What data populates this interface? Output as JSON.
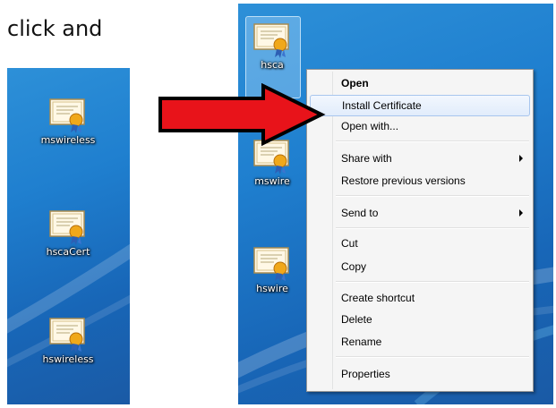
{
  "caption": "click and",
  "left_desktop": {
    "icons": [
      {
        "label": "mswireless",
        "icon": "certificate-icon"
      },
      {
        "label": "hscaCert",
        "icon": "certificate-icon"
      },
      {
        "label": "hswireless",
        "icon": "certificate-icon"
      }
    ]
  },
  "right_desktop": {
    "icons": [
      {
        "label": "hsca",
        "icon": "certificate-icon",
        "selected": true
      },
      {
        "label": "mswire",
        "icon": "certificate-icon"
      },
      {
        "label": "hswire",
        "icon": "certificate-icon"
      }
    ]
  },
  "context_menu": {
    "items": [
      {
        "label": "Open",
        "bold": true
      },
      {
        "label": "Install Certificate",
        "highlighted": true
      },
      {
        "label": "Open with..."
      },
      {
        "label": "Share with",
        "submenu": true
      },
      {
        "label": "Restore previous versions"
      },
      {
        "label": "Send to",
        "submenu": true
      },
      {
        "label": "Cut"
      },
      {
        "label": "Copy"
      },
      {
        "label": "Create shortcut"
      },
      {
        "label": "Delete"
      },
      {
        "label": "Rename"
      },
      {
        "label": "Properties"
      }
    ]
  },
  "colors": {
    "arrow_fill": "#e8131a",
    "arrow_stroke": "#000000",
    "desktop_blue": "#1f7fcf",
    "menu_bg": "#f5f5f5",
    "highlight_border": "#a8c6ee"
  }
}
